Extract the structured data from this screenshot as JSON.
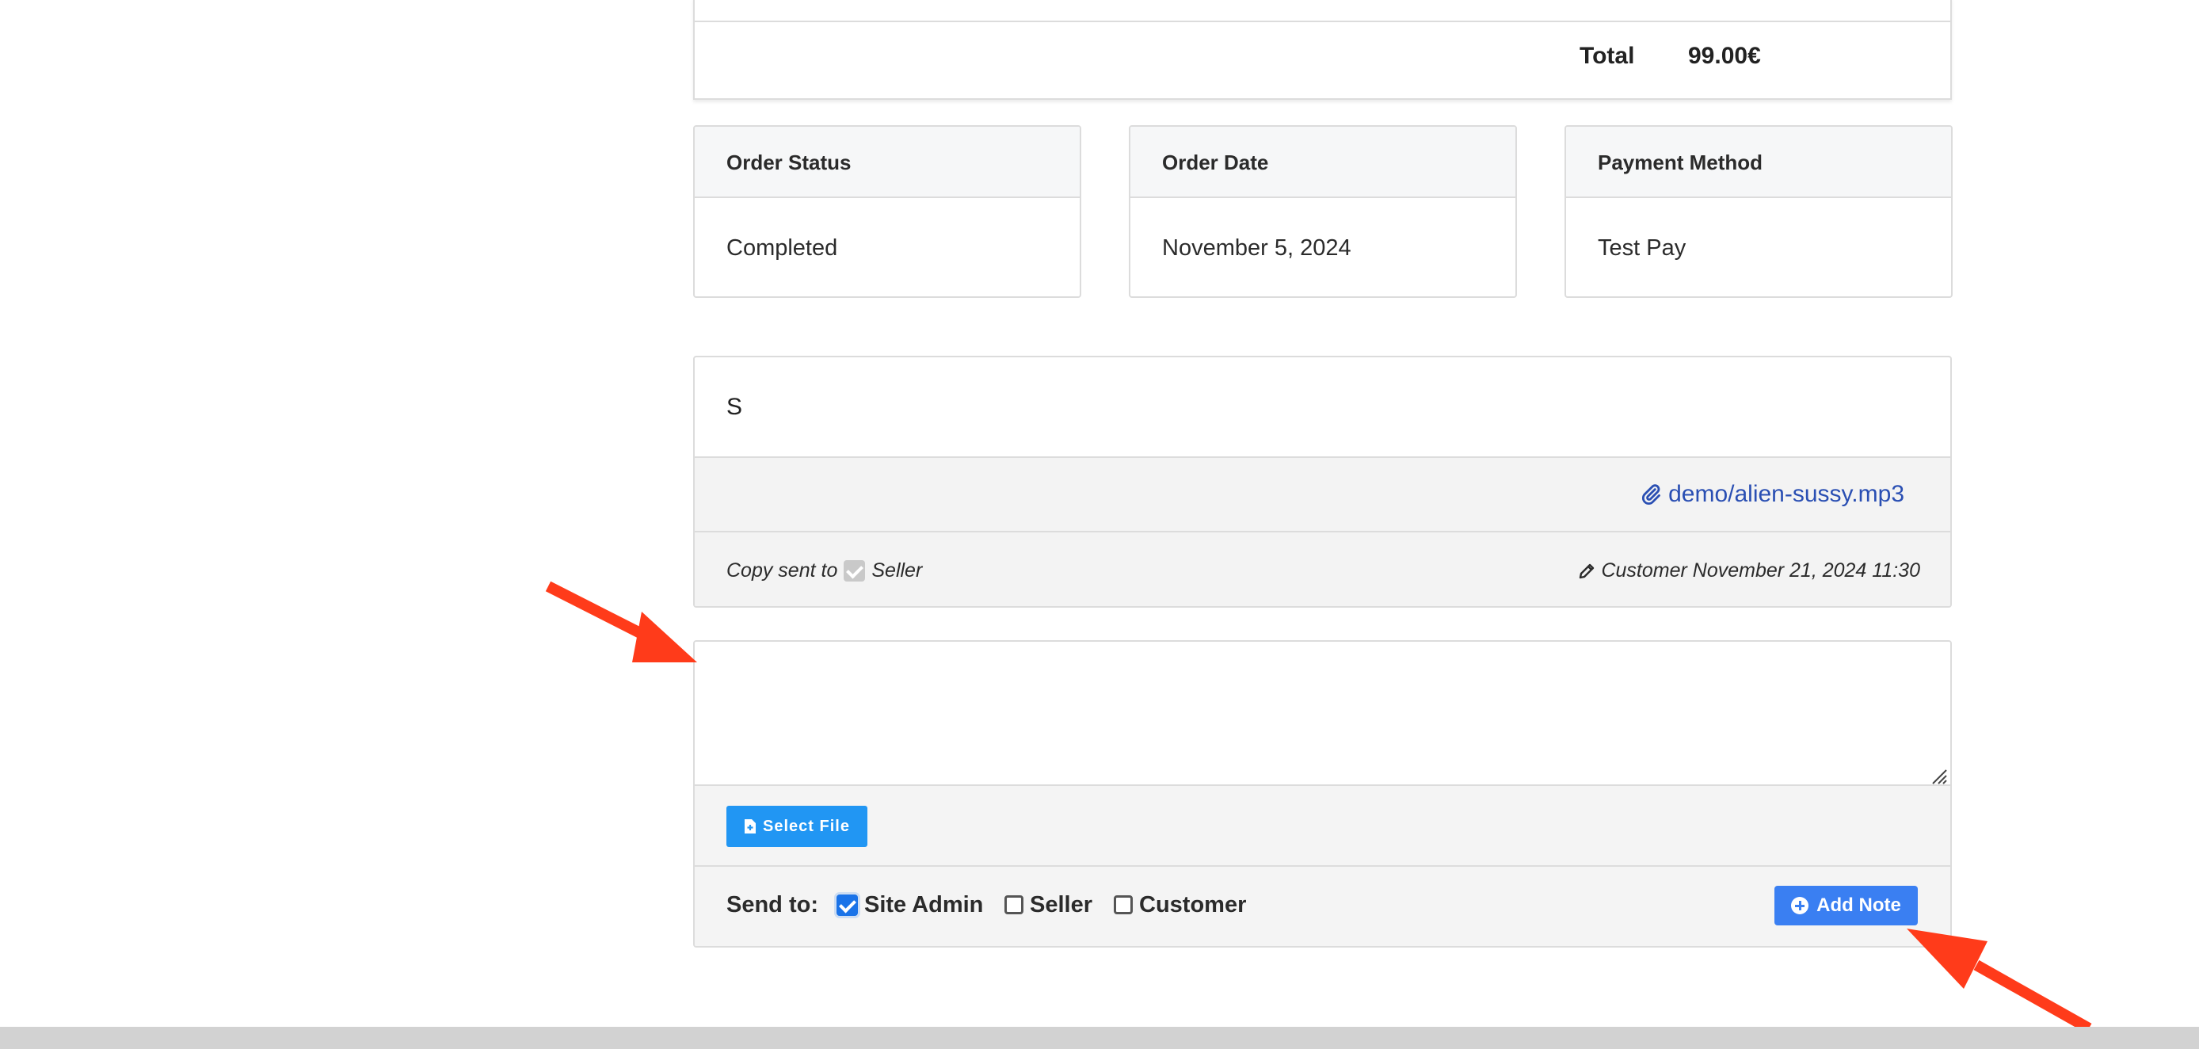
{
  "totals": {
    "label": "Total",
    "value": "99.00€"
  },
  "info_cards": [
    {
      "label": "Order Status",
      "value": "Completed"
    },
    {
      "label": "Order Date",
      "value": "November 5, 2024"
    },
    {
      "label": "Payment Method",
      "value": "Test Pay"
    }
  ],
  "note": {
    "text": "S",
    "attachment": "demo/alien-sussy.mp3",
    "copy_sent_to": "Copy sent to",
    "copy_recipient": "Seller",
    "author_meta": "Customer November 21, 2024 11:30"
  },
  "compose": {
    "textarea_value": "",
    "select_file_label": "Select File",
    "send_to_label": "Send to:",
    "recipients": [
      {
        "label": "Site Admin",
        "checked": true
      },
      {
        "label": "Seller",
        "checked": false
      },
      {
        "label": "Customer",
        "checked": false
      }
    ],
    "add_note_label": "Add Note"
  },
  "colors": {
    "primary_button": "#2196f3",
    "add_note_button": "#3a7ff2",
    "link": "#2a4fb3",
    "annotation_arrow": "#ff3b1a"
  },
  "icons": [
    "paperclip-icon",
    "pencil-icon",
    "file-plus-icon",
    "plus-circle-icon",
    "resize-grip-icon",
    "arrow-annotation-icon"
  ]
}
